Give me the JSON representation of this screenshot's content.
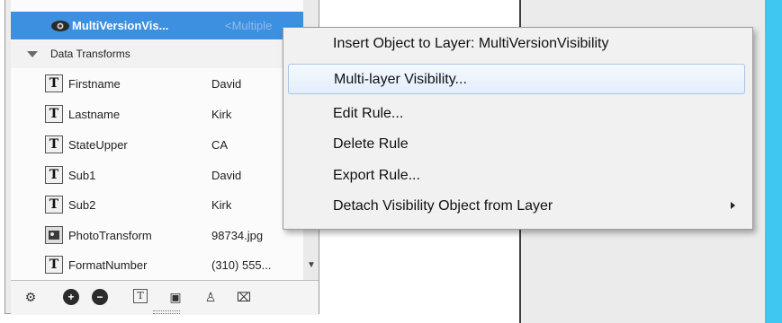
{
  "layers_panel": {
    "selected_layer": {
      "name": "MultiVersionVis...",
      "value": "<Multiple"
    },
    "group": {
      "label": "Data Transforms"
    },
    "rows": [
      {
        "name": "Firstname",
        "value": "David",
        "icon": "text-transform-icon"
      },
      {
        "name": "Lastname",
        "value": "Kirk",
        "icon": "text-transform-icon"
      },
      {
        "name": "StateUpper",
        "value": "CA",
        "icon": "text-transform-icon"
      },
      {
        "name": "Sub1",
        "value": "David",
        "icon": "text-transform-icon"
      },
      {
        "name": "Sub2",
        "value": "Kirk",
        "icon": "text-transform-icon"
      },
      {
        "name": "PhotoTransform",
        "value": "98734.jpg",
        "icon": "photo-transform-icon"
      },
      {
        "name": "FormatNumber",
        "value": "(310) 555...",
        "icon": "text-transform-icon"
      }
    ],
    "toolbar_icons": [
      "gear-icon",
      "add-icon",
      "remove-icon",
      "text-icon",
      "image-icon",
      "paint-icon",
      "trash-icon"
    ]
  },
  "context_menu": {
    "items": [
      {
        "label": "Insert Object to Layer: MultiVersionVisibility"
      },
      {
        "label": "Multi-layer Visibility..."
      },
      {
        "label": "Edit Rule..."
      },
      {
        "label": "Delete Rule"
      },
      {
        "label": "Export Rule..."
      },
      {
        "label": "Detach Visibility Object from Layer"
      }
    ],
    "highlighted_index": 1
  },
  "colors": {
    "selection": "#3d8fe0",
    "menu_background": "#f1f1f1",
    "menu_highlight": "#e3eefb",
    "stage_accent": "#3fc7f1"
  }
}
